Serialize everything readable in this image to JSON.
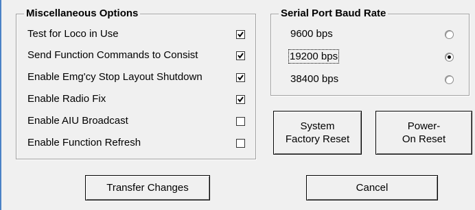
{
  "misc": {
    "title": "Miscellaneous Options",
    "options": [
      {
        "label": "Test for Loco in Use",
        "checked": true
      },
      {
        "label": "Send Function Commands to Consist",
        "checked": true
      },
      {
        "label": "Enable Emg'cy Stop Layout Shutdown",
        "checked": true
      },
      {
        "label": "Enable Radio Fix",
        "checked": true
      },
      {
        "label": "Enable AIU Broadcast",
        "checked": false
      },
      {
        "label": "Enable Function Refresh",
        "checked": false
      }
    ]
  },
  "baud": {
    "title": "Serial Port Baud Rate",
    "options": [
      {
        "label": "9600 bps",
        "selected": false
      },
      {
        "label": "19200 bps",
        "selected": true
      },
      {
        "label": "38400 bps",
        "selected": false
      }
    ]
  },
  "buttons": {
    "factory_reset": "System Factory Reset",
    "poweron_reset": "Power-On Reset",
    "transfer": "Transfer Changes",
    "cancel": "Cancel"
  }
}
